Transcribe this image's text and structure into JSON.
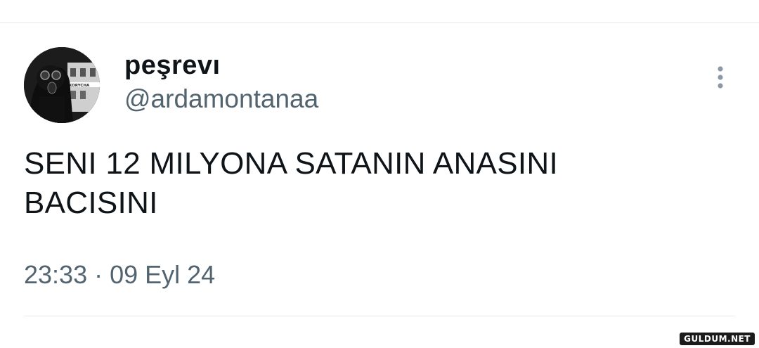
{
  "tweet": {
    "author": {
      "display_name": "peşrevı",
      "handle": "@ardamontanaa",
      "avatar_icon": "profile-avatar-gas-mask-photo",
      "avatar_sign_text": "KORYCHA"
    },
    "text_lines": [
      "SENI 12 MILYONA SATANIN ANASINI",
      "BACISINI"
    ],
    "time": "23:33",
    "separator": "·",
    "date": "09 Eyl 24",
    "more_icon": "vertical-ellipsis-icon"
  },
  "watermark": {
    "text": "GULDUM.NET"
  },
  "colors": {
    "text": "#0f1419",
    "secondary": "#536471",
    "divider": "#e6e9ec",
    "more_icon": "#8b98a5"
  }
}
